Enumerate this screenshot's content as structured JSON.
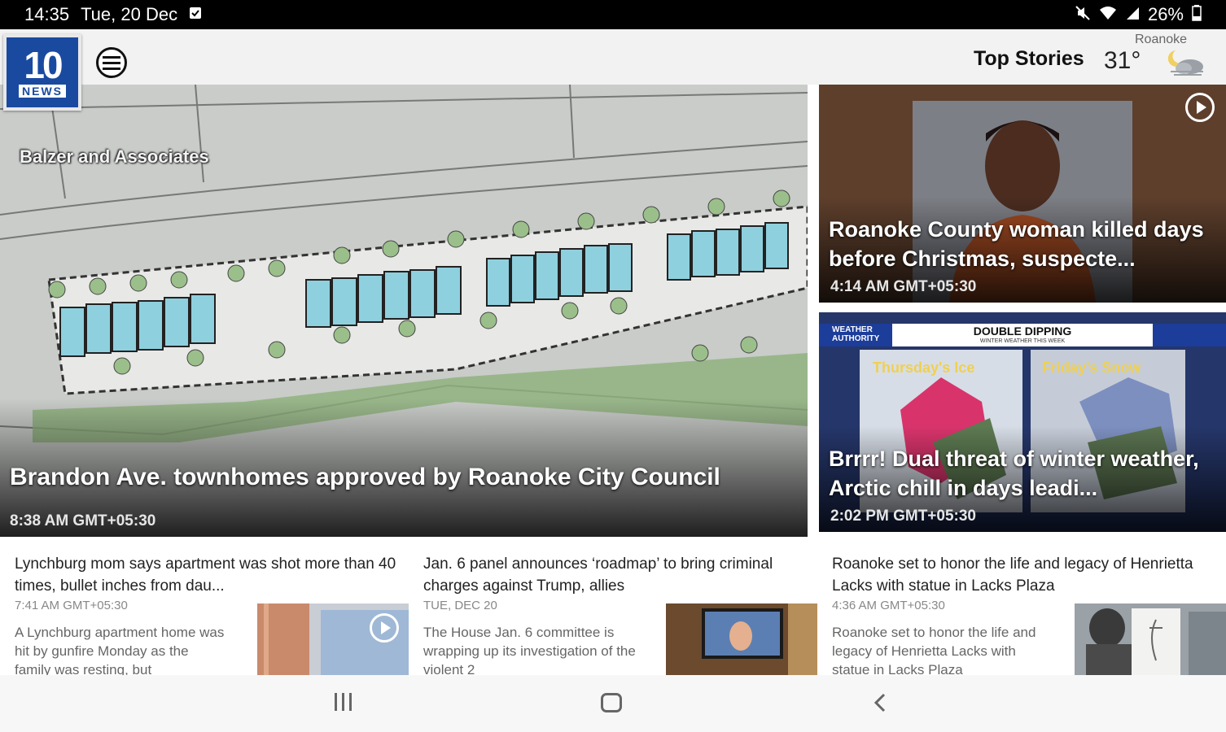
{
  "status_bar": {
    "time": "14:35",
    "date": "Tue, 20 Dec",
    "battery": "26%"
  },
  "header": {
    "logo_number": "10",
    "logo_word": "NEWS",
    "section_title": "Top Stories",
    "weather": {
      "city": "Roanoke",
      "temperature": "31°",
      "icon": "night-cloud-icon"
    }
  },
  "hero": {
    "image_label": "Balzer and Associates",
    "headline": "Brandon Ave. townhomes approved by Roanoke City Council",
    "time": "8:38 AM GMT+05:30"
  },
  "side_stories": [
    {
      "headline": "Roanoke County woman killed days before Christmas, suspecte...",
      "time": "4:14 AM GMT+05:30",
      "has_video": true
    },
    {
      "banner_left": "WEATHER AUTHORITY",
      "banner_title": "DOUBLE DIPPING",
      "banner_sub": "WINTER WEATHER THIS WEEK",
      "map_left_label": "Thursday's Ice",
      "map_right_label": "Friday's Snow",
      "headline": "Brrrr! Dual threat of winter weather, Arctic chill in days leadi...",
      "time": "2:02 PM GMT+05:30"
    }
  ],
  "stories": [
    {
      "title": "Lynchburg mom says apartment was shot more than 40 times, bullet inches from dau...",
      "date": "7:41 AM GMT+05:30",
      "summary": "A Lynchburg apartment home was hit by gunfire Monday as the family was resting, but",
      "has_video": true
    },
    {
      "title": "Jan. 6 panel announces ‘roadmap’ to bring criminal charges against Trump, allies",
      "date": "TUE, DEC 20",
      "summary": "The House Jan. 6 committee is wrapping up its investigation of the violent 2",
      "has_video": false
    },
    {
      "title": "Roanoke set to honor the life and legacy of Henrietta Lacks with statue in Lacks Plaza",
      "date": "4:36 AM GMT+05:30",
      "summary": "Roanoke set to honor the life and legacy of Henrietta Lacks with statue in Lacks Plaza",
      "has_video": false
    }
  ],
  "colors": {
    "brand_blue": "#1a4aa0",
    "app_bar": "#f2f2f2",
    "status_bar": "#000000"
  }
}
